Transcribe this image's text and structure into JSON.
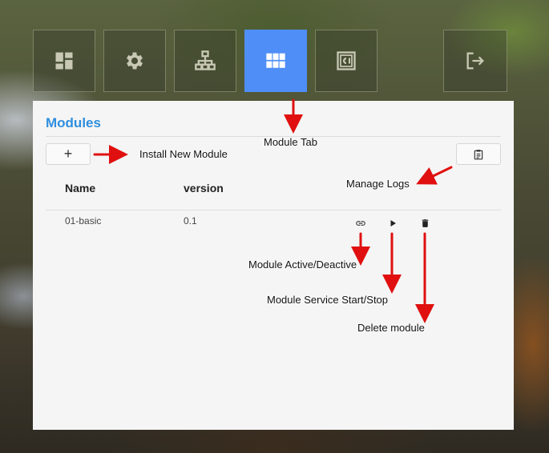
{
  "nav": {
    "tiles": [
      {
        "icon": "dashboard-icon"
      },
      {
        "icon": "gear-icon"
      },
      {
        "icon": "sitemap-icon"
      },
      {
        "icon": "grid-icon",
        "active": true
      },
      {
        "icon": "chip-icon"
      },
      {
        "icon": "logout-icon"
      }
    ],
    "active_color": "#4f8ef7"
  },
  "panel": {
    "title": "Modules",
    "add_button_label": "+",
    "logs_button_icon": "clipboard-icon",
    "table": {
      "columns": [
        "Name",
        "version"
      ],
      "rows": [
        {
          "name": "01-basic",
          "version": "0.1",
          "actions": [
            "link-icon",
            "play-icon",
            "trash-icon"
          ]
        }
      ]
    }
  },
  "annotations": {
    "module_tab": "Module Tab",
    "install": "Install New Module",
    "logs": "Manage Logs",
    "active": "Module Active/Deactive",
    "service": "Module Service Start/Stop",
    "delete": "Delete module"
  },
  "colors": {
    "title": "#2f8fdf",
    "arrow": "#e01010"
  }
}
